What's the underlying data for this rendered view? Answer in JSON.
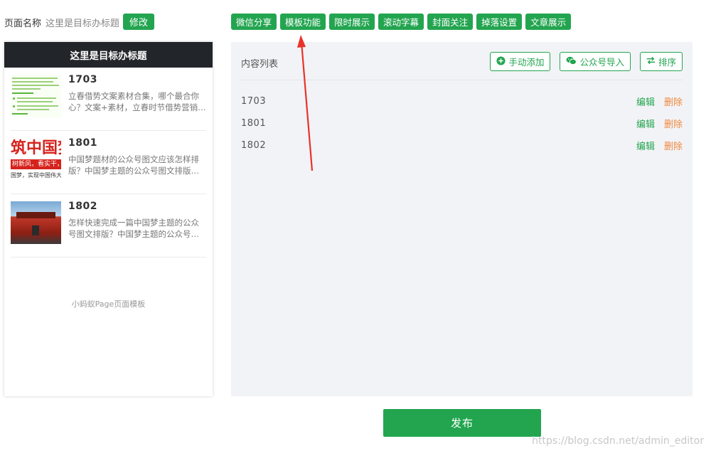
{
  "header": {
    "page_name_label": "页面名称",
    "page_name_value": "这里是目标办标题",
    "edit_button": "修改",
    "tabs": [
      "微信分享",
      "模板功能",
      "限时展示",
      "滚动字幕",
      "封面关注",
      "掉落设置",
      "文章展示"
    ]
  },
  "preview": {
    "title": "这里是目标办标题",
    "articles": [
      {
        "title": "1703",
        "desc": "立春借势文案素材合集，哪个最合你心？文案+素材，立春时节借势营销…"
      },
      {
        "title": "1801",
        "desc": "中国梦题材的公众号图文应该怎样排版？中国梦主题的公众号图文排版…"
      },
      {
        "title": "1802",
        "desc": "怎样快速完成一篇中国梦主题的公众号图文排版？中国梦主题的公众号…"
      }
    ],
    "thumb2": {
      "big": "筑中国梦",
      "band": "树新风，看实干，",
      "small": "国梦，实现中国伟大"
    },
    "footer": "小蚂蚁Page页面模板"
  },
  "content": {
    "title": "内容列表",
    "buttons": {
      "manual_add": "手动添加",
      "wechat_import": "公众号导入",
      "sort": "排序"
    },
    "rows": [
      {
        "id": "1703",
        "edit": "编辑",
        "delete": "删除"
      },
      {
        "id": "1801",
        "edit": "编辑",
        "delete": "删除"
      },
      {
        "id": "1802",
        "edit": "编辑",
        "delete": "删除"
      }
    ]
  },
  "publish_label": "发布",
  "watermark": "https://blog.csdn.net/admin_editor",
  "colors": {
    "accent": "#23a550",
    "delete": "#f0883e",
    "preview_header": "#22262a",
    "panel_bg": "#f2f3f6",
    "annotation_arrow": "#e8332a"
  },
  "icons": {
    "manual_add": "plus-circle-icon",
    "wechat_import": "wechat-icon",
    "sort": "swap-arrows-icon"
  }
}
